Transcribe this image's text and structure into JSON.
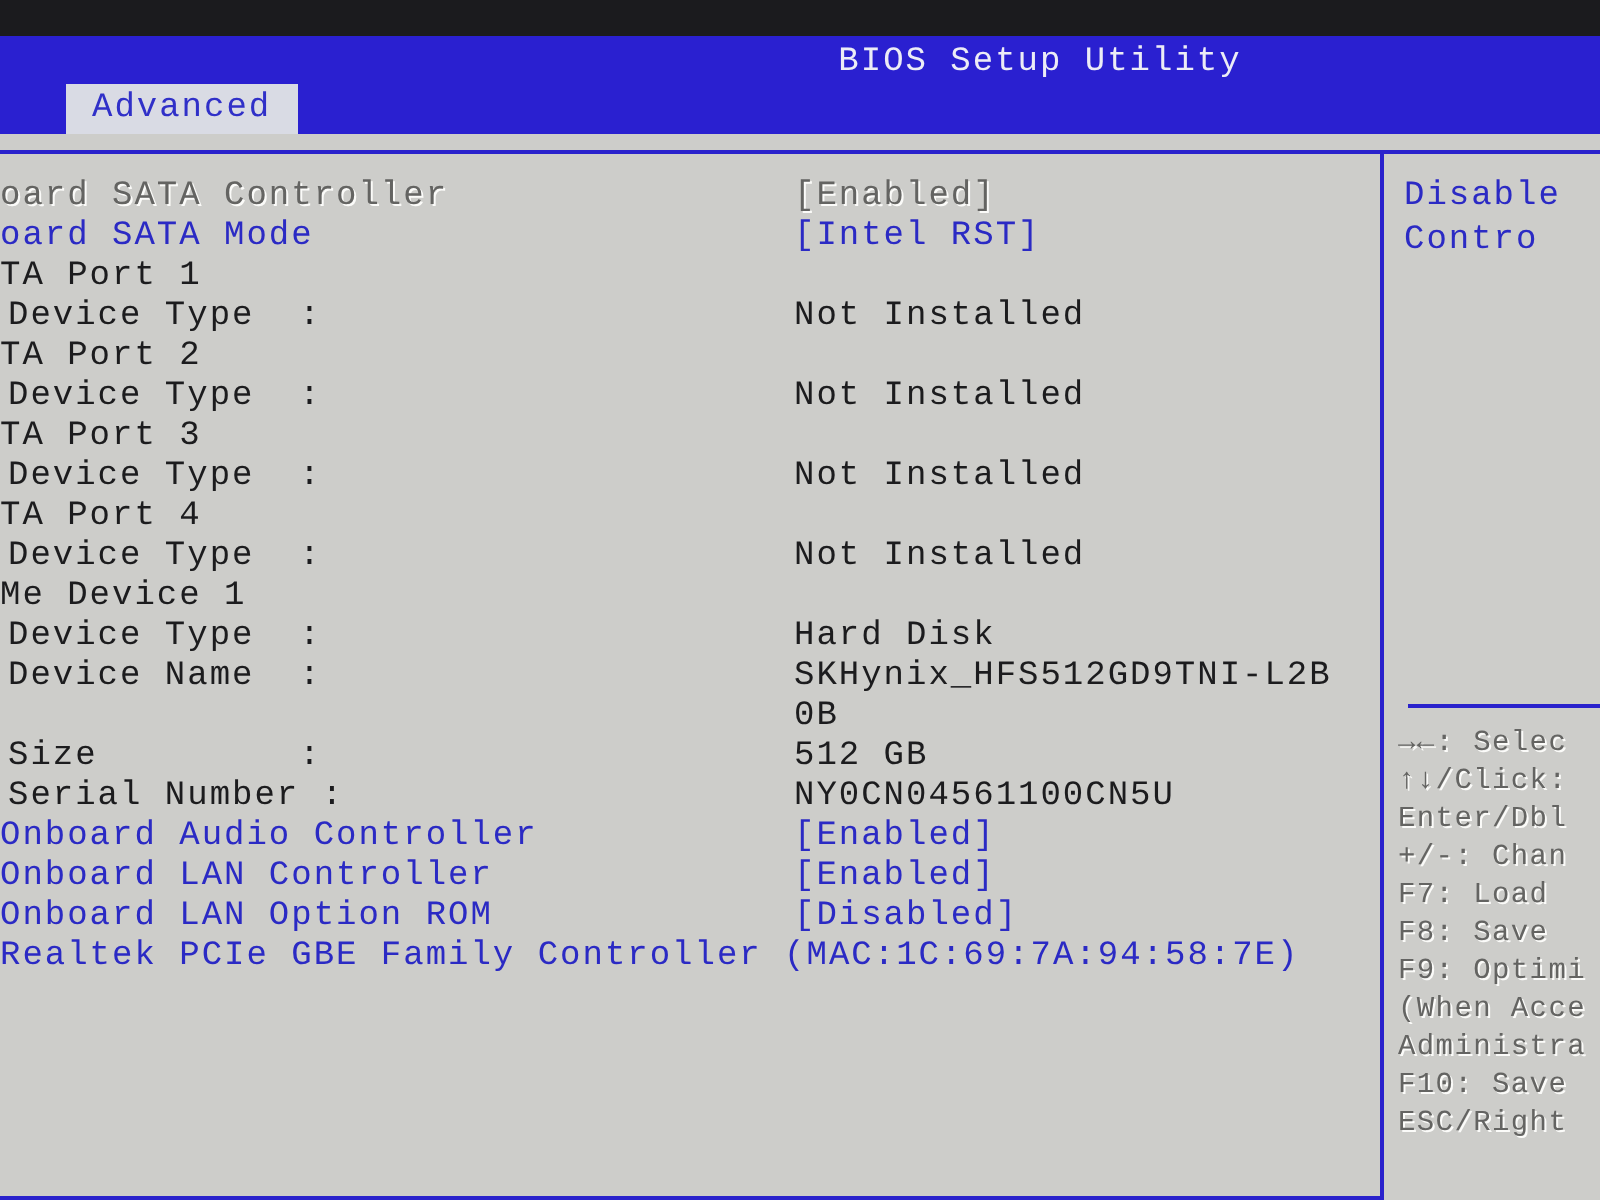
{
  "window": {
    "title": "BIOS Setup Utility"
  },
  "tabs": [
    {
      "label": "Advanced",
      "selected": true
    }
  ],
  "settings": [
    {
      "kind": "option",
      "label": "oard SATA Controller",
      "value": "[Enabled]",
      "selected": true
    },
    {
      "kind": "option",
      "label": "oard SATA Mode",
      "value": "[Intel RST]",
      "selected": false
    },
    {
      "kind": "heading",
      "label": "TA Port 1",
      "selected": false
    },
    {
      "kind": "info",
      "label": "Device Type  :",
      "value": "Not Installed",
      "selected": false
    },
    {
      "kind": "heading",
      "label": "TA Port 2",
      "selected": false
    },
    {
      "kind": "info",
      "label": "Device Type  :",
      "value": "Not Installed",
      "selected": false
    },
    {
      "kind": "heading",
      "label": "TA Port 3",
      "selected": false
    },
    {
      "kind": "info",
      "label": "Device Type  :",
      "value": "Not Installed",
      "selected": false
    },
    {
      "kind": "heading",
      "label": "TA Port 4",
      "selected": false
    },
    {
      "kind": "info",
      "label": "Device Type  :",
      "value": "Not Installed",
      "selected": false
    },
    {
      "kind": "heading",
      "label": "Me Device 1",
      "selected": false
    },
    {
      "kind": "info",
      "label": "Device Type  :",
      "value": "Hard Disk",
      "selected": false
    },
    {
      "kind": "info",
      "label": "Device Name  :",
      "value": "SKHynix_HFS512GD9TNI-L2B0B",
      "selected": false
    },
    {
      "kind": "info",
      "label": "Size         :",
      "value": "512 GB",
      "selected": false
    },
    {
      "kind": "info",
      "label": "Serial Number :",
      "value": "NY0CN04561100CN5U",
      "selected": false
    },
    {
      "kind": "option",
      "label": "Onboard Audio Controller",
      "value": "[Enabled]",
      "selected": false
    },
    {
      "kind": "option",
      "label": "Onboard LAN Controller",
      "value": "[Enabled]",
      "selected": false
    },
    {
      "kind": "option",
      "label": "Onboard LAN Option ROM",
      "value": "[Disabled]",
      "selected": false
    },
    {
      "kind": "option",
      "label": "Realtek PCIe GBE Family Controller (MAC:1C:69:7A:94:58:7E)",
      "selected": false
    }
  ],
  "help": {
    "description": [
      "Disable",
      "Contro"
    ],
    "keys": [
      "→←: Selec",
      "↑↓/Click:",
      "Enter/Dbl",
      "+/-: Chan",
      "F7: Load",
      "F8: Save",
      "F9: Optimi",
      "(When Acce",
      "Administra",
      "F10: Save",
      "ESC/Right"
    ]
  }
}
